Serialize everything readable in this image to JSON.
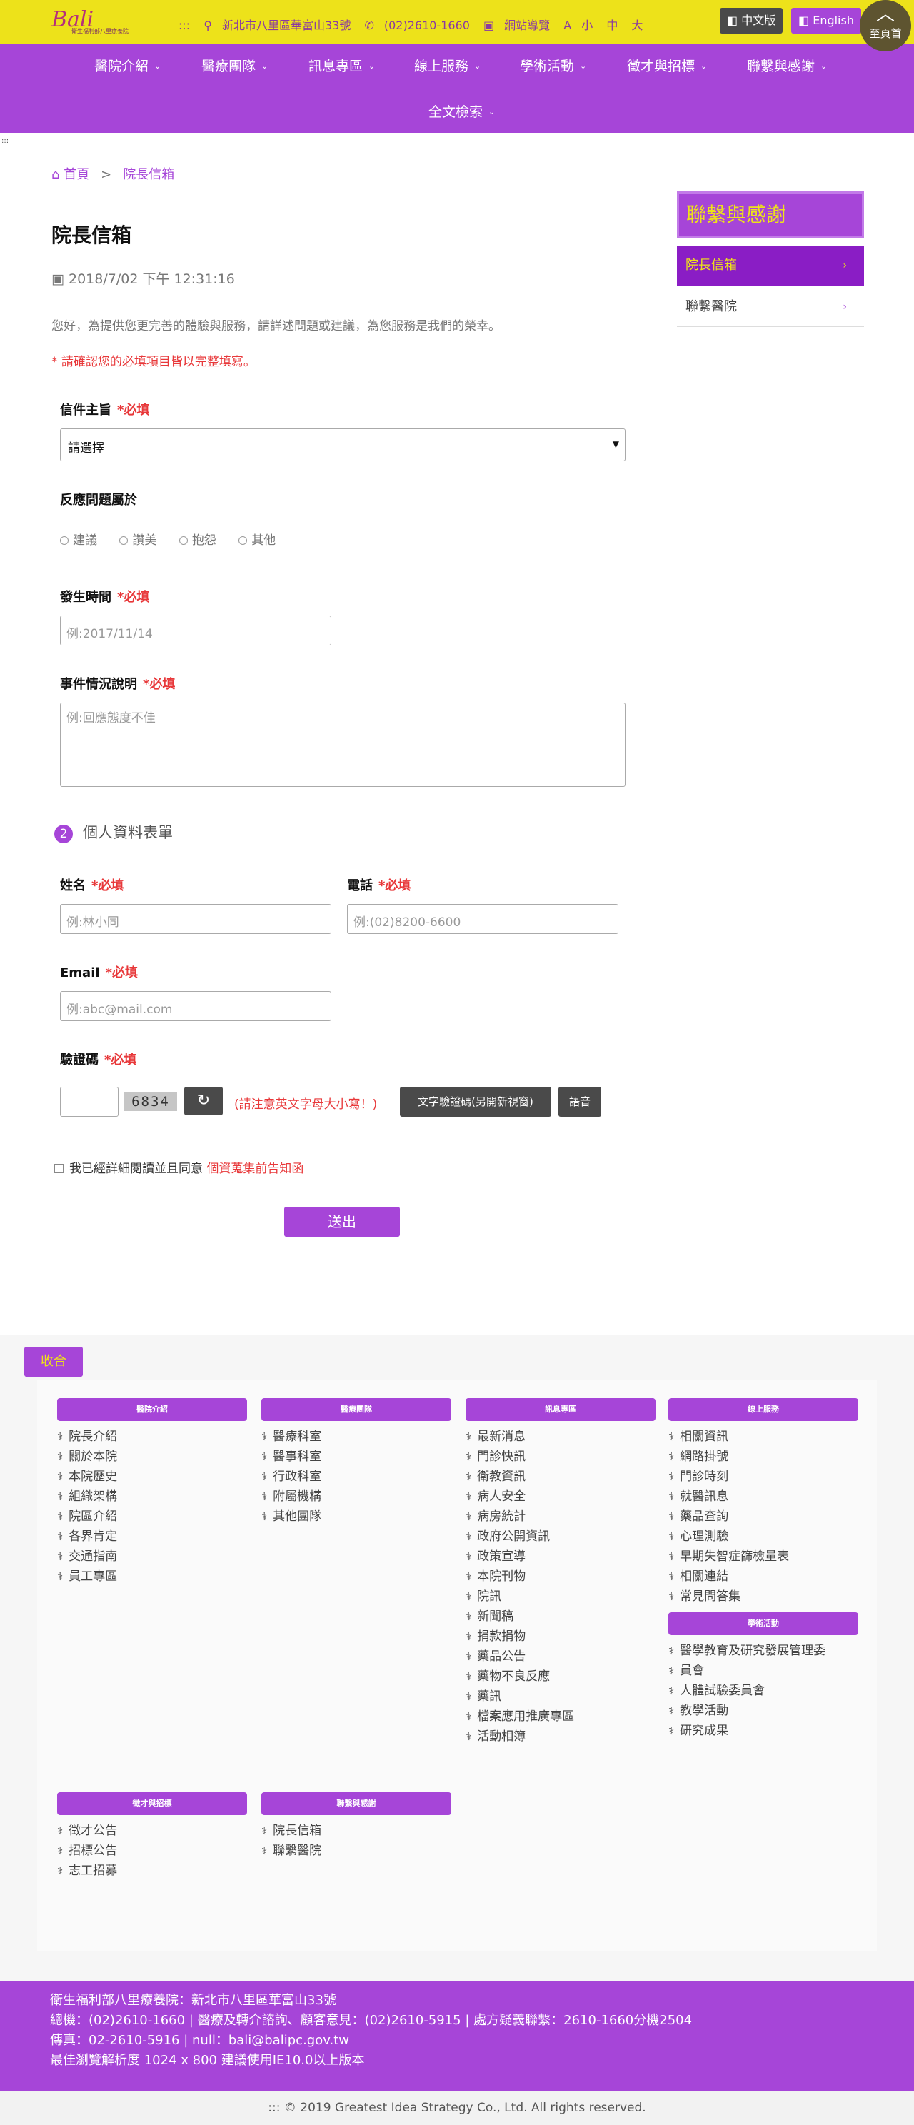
{
  "header": {
    "logo_text": "Bali",
    "logo_sub": "衛生福利部八里療養院",
    "address": "新北市八里區華富山33號",
    "phone": "(02)2610-1660",
    "guide": "網站導覽",
    "font_a": "A",
    "font_small": "小",
    "font_mid": "中",
    "font_large": "大",
    "lang_zh": "中文版",
    "lang_en": "English",
    "totop": "至頁首"
  },
  "nav": {
    "items": [
      "醫院介紹",
      "醫療團隊",
      "訊息專區",
      "線上服務",
      "學術活動",
      "徵才與招標",
      "聯繫與感謝",
      "全文檢索"
    ]
  },
  "breadcrumb": {
    "home": "首頁",
    "sep": ">",
    "current": "院長信箱"
  },
  "page": {
    "title": "院長信箱",
    "date": "2018/7/02 下午 12:31:16",
    "intro": "您好，為提供您更完善的體驗與服務，請詳述問題或建議，為您服務是我們的榮幸。",
    "warning": "* 請確認您的必填項目皆以完整填寫。"
  },
  "form": {
    "required_mark": "*必填",
    "subject_label": "信件主旨",
    "subject_value": "請選擇",
    "type_label": "反應問題屬於",
    "type_options": [
      "建議",
      "讚美",
      "抱怨",
      "其他"
    ],
    "time_label": "發生時間",
    "time_placeholder": "例:2017/11/14",
    "desc_label": "事件情況說明",
    "desc_placeholder": "例:回應態度不佳",
    "section2_num": "2",
    "section2_title": "個人資料表單",
    "name_label": "姓名",
    "name_placeholder": "例:林小同",
    "phone_label": "電話",
    "phone_placeholder": "例:(02)8200-6600",
    "email_label": "Email",
    "email_placeholder": "例:abc@mail.com",
    "captcha_label": "驗證碼",
    "captcha_code": "6834",
    "captcha_note": "(請注意英文字母大小寫！)",
    "text_captcha": "文字驗證碼(另開新視窗)",
    "audio": "語音",
    "agree_text": "我已經詳細閱讀並且同意",
    "agree_link": "個資蒐集前告知函",
    "submit": "送出"
  },
  "sidebar": {
    "title": "聯繫與感謝",
    "items": [
      "院長信箱",
      "聯繫醫院"
    ]
  },
  "sitemap": {
    "collapse": "收合",
    "columns": [
      {
        "title": "醫院介紹",
        "links": [
          "院長介紹",
          "關於本院",
          "本院歷史",
          "組織架構",
          "院區介紹",
          "各界肯定",
          "交通指南",
          "員工專區"
        ]
      },
      {
        "title": "醫療團隊",
        "links": [
          "醫療科室",
          "醫事科室",
          "行政科室",
          "附屬機構",
          "其他團隊"
        ]
      },
      {
        "title": "訊息專區",
        "links": [
          "最新消息",
          "門診快訊",
          "衛教資訊",
          "病人安全",
          "病房統計",
          "政府公開資訊",
          "政策宣導",
          "本院刊物",
          "院訊",
          "新聞稿",
          "捐款捐物",
          "藥品公告",
          "藥物不良反應",
          "藥訊",
          "檔案應用推廣專區",
          "活動相簿"
        ]
      },
      {
        "title": "線上服務",
        "links": [
          "相關資訊",
          "網路掛號",
          "門診時刻",
          "就醫訊息",
          "藥品查詢",
          "心理測驗",
          "早期失智症篩檢量表",
          "相關連結",
          "常見問答集"
        ]
      },
      {
        "title": "學術活動",
        "links": [
          "醫學教育及研究發展管理委",
          "員會",
          "人體試驗委員會",
          "教學活動",
          "研究成果"
        ]
      },
      {
        "title": "徵才與招標",
        "links": [
          "徵才公告",
          "招標公告",
          "志工招募"
        ]
      },
      {
        "title": "聯繫與感謝",
        "links": [
          "院長信箱",
          "聯繫醫院"
        ]
      }
    ]
  },
  "footer": {
    "lines": [
      "衛生福利部八里療養院：新北市八里區華富山33號",
      "總機：(02)2610-1660 | 醫療及轉介諮詢、顧客意見：(02)2610-5915 | 處方疑義聯繫：2610-1660分機2504",
      "傳真：02-2610-5916 | null：bali@balipc.gov.tw",
      "最佳瀏覽解析度 1024 x 800 建議使用IE10.0以上版本"
    ],
    "copyright": "::: © 2019 Greatest Idea Strategy Co., Ltd. All rights reserved."
  },
  "colors": {
    "primary": "#a645d8",
    "topbar": "#ede21a",
    "active": "#8a1dc5",
    "required": "#e8383a"
  }
}
